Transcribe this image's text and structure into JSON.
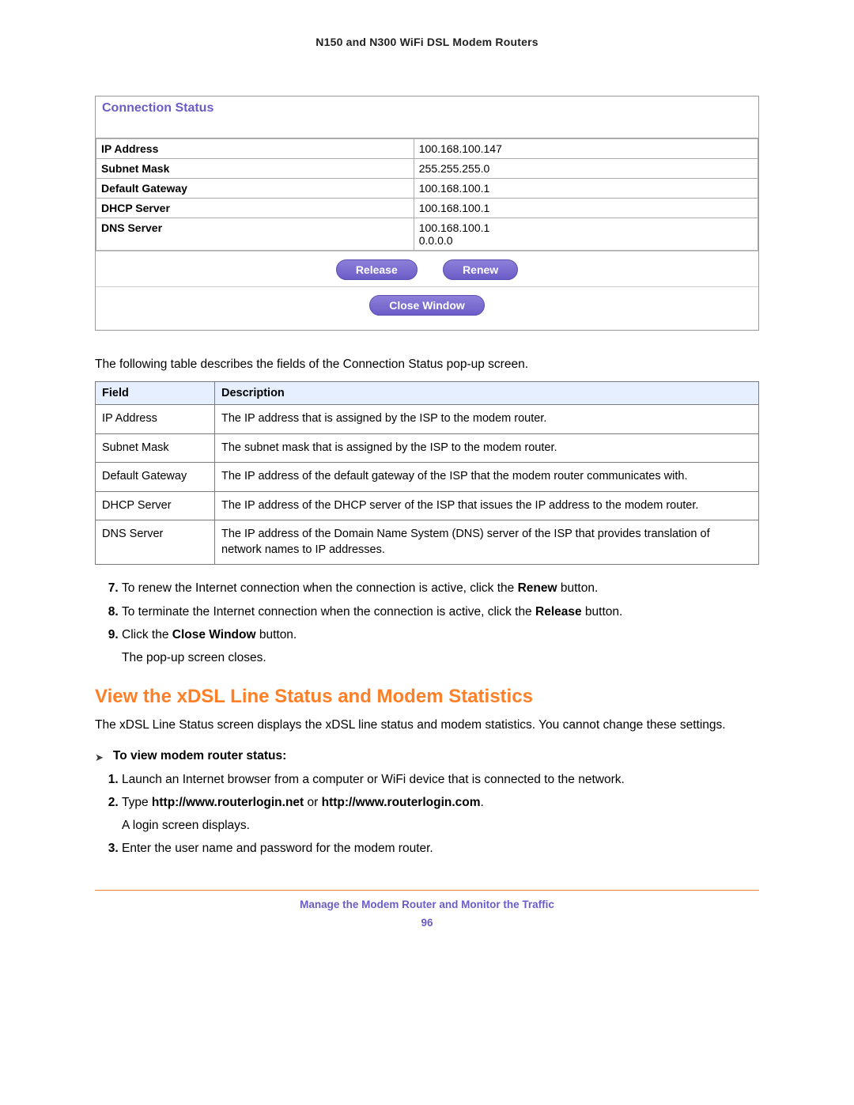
{
  "doc_title": "N150 and N300 WiFi DSL Modem Routers",
  "status": {
    "header": "Connection Status",
    "rows": [
      {
        "label": "IP Address",
        "value": "100.168.100.147"
      },
      {
        "label": "Subnet Mask",
        "value": "255.255.255.0"
      },
      {
        "label": "Default Gateway",
        "value": "100.168.100.1"
      },
      {
        "label": "DHCP Server",
        "value": "100.168.100.1"
      },
      {
        "label": "DNS Server",
        "value": "100.168.100.1\n0.0.0.0"
      }
    ],
    "btn_release": "Release",
    "btn_renew": "Renew",
    "btn_close": "Close Window"
  },
  "intro": "The following table describes the fields of the Connection Status pop-up screen.",
  "desc_table": {
    "head_field": "Field",
    "head_desc": "Description",
    "rows": [
      {
        "field": "IP Address",
        "desc": "The IP address that is assigned by the ISP to the modem router."
      },
      {
        "field": "Subnet Mask",
        "desc": "The subnet mask that is assigned by the ISP to the modem router."
      },
      {
        "field": "Default Gateway",
        "desc": "The IP address of the default gateway of the ISP that the modem router communicates with."
      },
      {
        "field": "DHCP Server",
        "desc": "The IP address of the DHCP server of the ISP that issues the IP address to the modem router."
      },
      {
        "field": "DNS Server",
        "desc": "The IP address of the Domain Name System (DNS) server of the ISP that provides translation of network names to IP addresses."
      }
    ]
  },
  "steps_a": {
    "s7_pre": "To renew the Internet connection when the connection is active, click the ",
    "s7_bold": "Renew",
    "s7_post": " button.",
    "s8_pre": "To terminate the Internet connection when the connection is active, click the ",
    "s8_bold": "Release",
    "s8_post": " button.",
    "s9_pre": "Click the ",
    "s9_bold": "Close Window",
    "s9_post": " button.",
    "s9_sub": "The pop-up screen closes."
  },
  "section_heading": "View the xDSL Line Status and Modem Statistics",
  "section_para": "The xDSL Line Status screen displays the xDSL line status and modem statistics. You cannot change these settings.",
  "subhead": "To view modem router status:",
  "steps_b": {
    "s1": "Launch an Internet browser from a computer or WiFi device that is connected to the network.",
    "s2_pre": "Type ",
    "s2_bold_a": "http://www.routerlogin.net",
    "s2_mid": " or ",
    "s2_bold_b": "http://www.routerlogin.com",
    "s2_post": ".",
    "s2_sub": "A login screen displays.",
    "s3": "Enter the user name and password for the modem router."
  },
  "footer": "Manage the Modem Router and Monitor the Traffic",
  "page_number": "96"
}
